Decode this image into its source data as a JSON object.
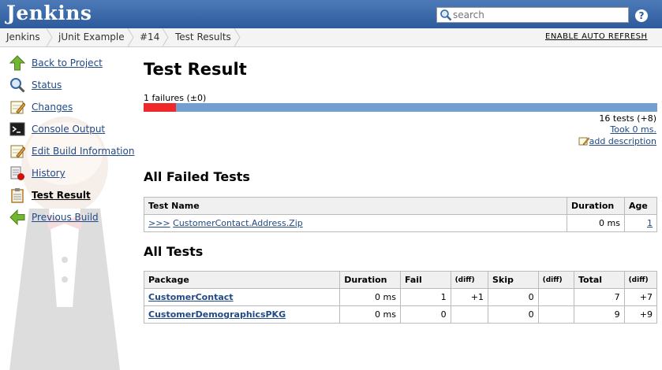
{
  "header": {
    "logo": "Jenkins",
    "search_placeholder": "search",
    "help_label": "?"
  },
  "breadcrumbs": [
    "Jenkins",
    "jUnit Example",
    "#14",
    "Test Results"
  ],
  "auto_refresh_label": "ENABLE AUTO REFRESH",
  "sidebar": {
    "items": [
      {
        "label": "Back to Project",
        "icon": "up-arrow-icon"
      },
      {
        "label": "Status",
        "icon": "search-icon"
      },
      {
        "label": "Changes",
        "icon": "notepad-icon"
      },
      {
        "label": "Console Output",
        "icon": "terminal-icon"
      },
      {
        "label": "Edit Build Information",
        "icon": "notepad-icon"
      },
      {
        "label": "History",
        "icon": "history-icon"
      },
      {
        "label": "Test Result",
        "icon": "clipboard-icon"
      },
      {
        "label": "Previous Build",
        "icon": "left-arrow-icon"
      }
    ]
  },
  "main": {
    "title": "Test Result",
    "failures_text": "1 failures (±0)",
    "fail_fraction": 0.0625,
    "tests_text": "16 tests (+8)",
    "took_text": "Took 0 ms.",
    "add_description": "add description",
    "failed_section_title": "All Failed Tests",
    "failed_table": {
      "headers": [
        "Test Name",
        "Duration",
        "Age"
      ],
      "rows": [
        {
          "prefix": ">>>",
          "name": "CustomerContact.Address.Zip",
          "duration": "0 ms",
          "age": "1"
        }
      ]
    },
    "all_section_title": "All Tests",
    "all_table": {
      "headers": [
        "Package",
        "Duration",
        "Fail",
        "(diff)",
        "Skip",
        "(diff)",
        "Total",
        "(diff)"
      ],
      "rows": [
        {
          "package": "CustomerContact",
          "duration": "0 ms",
          "fail": "1",
          "fail_diff": "+1",
          "skip": "0",
          "skip_diff": "",
          "total": "7",
          "total_diff": "+7"
        },
        {
          "package": "CustomerDemographicsPKG",
          "duration": "0 ms",
          "fail": "0",
          "fail_diff": "",
          "skip": "0",
          "skip_diff": "",
          "total": "9",
          "total_diff": "+9"
        }
      ]
    }
  },
  "colors": {
    "header_blue": "#2d5a9c",
    "fail_red": "#ef2929",
    "pass_blue": "#729fcf",
    "link": "#204a87"
  }
}
